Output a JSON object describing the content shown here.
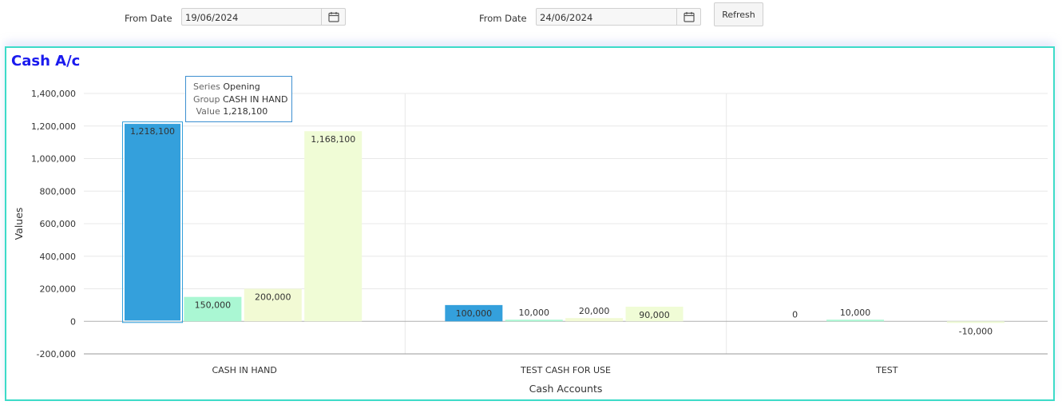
{
  "filters": {
    "from_label_1": "From Date",
    "from_value_1": "19/06/2024",
    "from_label_2": "From Date",
    "from_value_2": "24/06/2024",
    "refresh_label": "Refresh"
  },
  "panel": {
    "title": "Cash A/c"
  },
  "tooltip": {
    "series_key": "Series",
    "series_val": "Opening",
    "group_key": "Group",
    "group_val": "CASH IN HAND",
    "value_key": "Value",
    "value_val": "1,218,100"
  },
  "chart_data": {
    "type": "bar",
    "xlabel": "Cash Accounts",
    "ylabel": "Values",
    "ylim": [
      -200000,
      1400000
    ],
    "yticks": [
      -200000,
      0,
      200000,
      400000,
      600000,
      800000,
      1000000,
      1200000,
      1400000
    ],
    "grid": true,
    "categories": [
      "CASH IN HAND",
      "TEST CASH FOR USE",
      "TEST"
    ],
    "series": [
      {
        "values": [
          1218100,
          100000,
          0
        ],
        "color": "#34a0dc"
      },
      {
        "values": [
          150000,
          10000,
          10000
        ],
        "color": "#aaf7d3"
      },
      {
        "values": [
          200000,
          20000,
          0
        ],
        "color": "#f2fad4"
      },
      {
        "values": [
          1168100,
          90000,
          -10000
        ],
        "color": "#f0fcd6"
      }
    ],
    "data_labels": [
      [
        "1,218,100",
        "150,000",
        "200,000",
        "1,168,100"
      ],
      [
        "100,000",
        "10,000",
        "20,000",
        "90,000"
      ],
      [
        "0",
        "10,000",
        "",
        "-10,000"
      ]
    ],
    "highlight": {
      "category": 0,
      "series": 0
    }
  }
}
